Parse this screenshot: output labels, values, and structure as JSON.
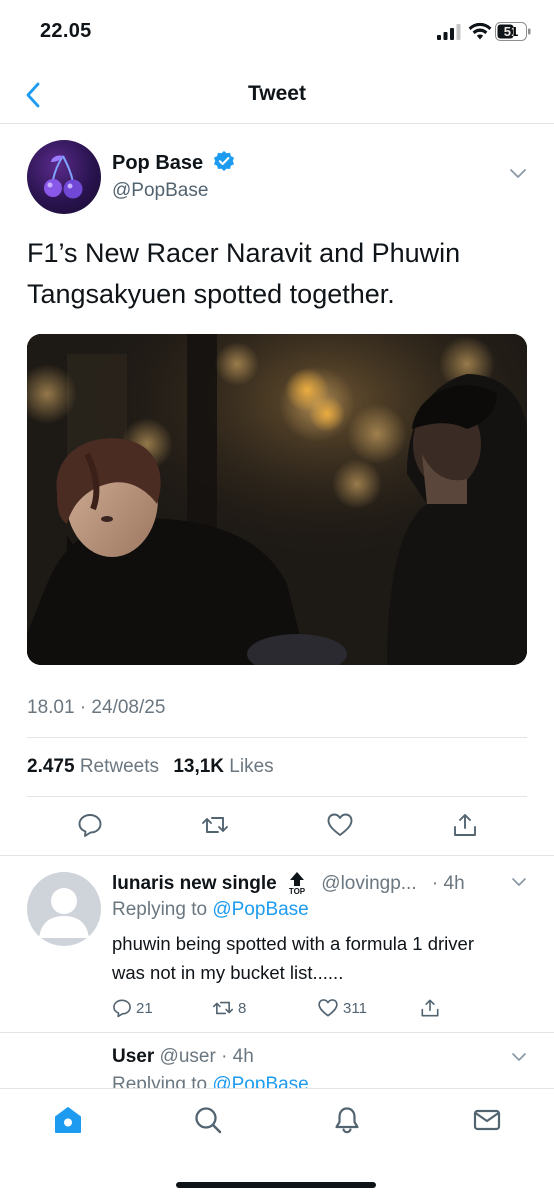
{
  "status_bar": {
    "time": "22.05",
    "battery": "51"
  },
  "nav": {
    "title": "Tweet",
    "back_icon": "chevron-left-icon"
  },
  "tweet": {
    "author_name": "Pop Base",
    "author_handle": "@PopBase",
    "text": "F1’s New Racer Naravit and Phuwin Tangsakyuen spotted together.",
    "timestamp": "18.01 · 24/08/25",
    "retweets_count": "2.475",
    "retweets_label": "Retweets",
    "likes_count": "13,1K",
    "likes_label": "Likes"
  },
  "replies": [
    {
      "name": "lunaris new single",
      "badge": "TOP",
      "handle": "@lovingp...",
      "time": "· 4h",
      "replying_prefix": "Replying to",
      "replying_to": "@PopBase",
      "text": "phuwin being spotted with a formula 1 driver was not in my bucket list......",
      "reply_count": "21",
      "retweet_count": "8",
      "like_count": "311"
    },
    {
      "name": "User",
      "handle": "@user",
      "time": "· 4h",
      "replying_prefix": "Replying to",
      "replying_to": "@PopBase"
    }
  ],
  "colors": {
    "accent": "#1d9bf0",
    "text": "#0f1419",
    "secondary": "#536471",
    "divider": "#e1e5e8"
  }
}
